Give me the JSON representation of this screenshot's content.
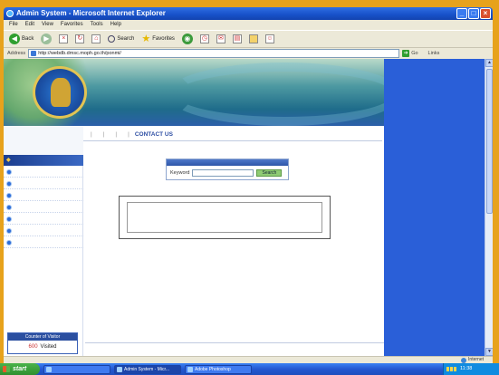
{
  "window": {
    "title": "Admin System - Microsoft Internet Explorer",
    "controls": {
      "minimize": "_",
      "maximize": "□",
      "close": "×"
    }
  },
  "menubar": {
    "items": [
      "File",
      "Edit",
      "View",
      "Favorites",
      "Tools",
      "Help"
    ]
  },
  "toolbar": {
    "back_label": "Back",
    "search_label": "Search",
    "favorites_label": "Favorites"
  },
  "addressbar": {
    "label": "Address",
    "url": "http://webdb.dmsc.moph.go.th/ponmi/",
    "go_label": "Go",
    "links_label": "Links"
  },
  "website": {
    "banner_title": "",
    "banner_subtitle": "",
    "nav": {
      "items": [
        "",
        "",
        "",
        ""
      ],
      "contact_label": "CONTACT US"
    },
    "sidebar": {
      "header": "",
      "items": [
        "",
        "",
        "",
        "",
        "",
        "",
        ""
      ]
    },
    "counter": {
      "title": "Counter of Visitor",
      "number": "600",
      "suffix": "Visited"
    },
    "search": {
      "title": "",
      "keyword_label": "Keyword",
      "keyword_value": "",
      "button_label": "Search"
    },
    "info_text": "",
    "footer": ""
  },
  "statusbar": {
    "zone_label": "Internet"
  },
  "taskbar": {
    "start_label": "start",
    "tasks": [
      "",
      "Admin System - Micr...",
      "Adobe Photoshop"
    ],
    "clock": "11:38"
  },
  "colors": {
    "taskbar": "#2458d1",
    "titlebar": "#1750c8",
    "banner": "#1f6c8a",
    "nav_link": "#2d4ea3",
    "search_button": "#8fcb74"
  }
}
